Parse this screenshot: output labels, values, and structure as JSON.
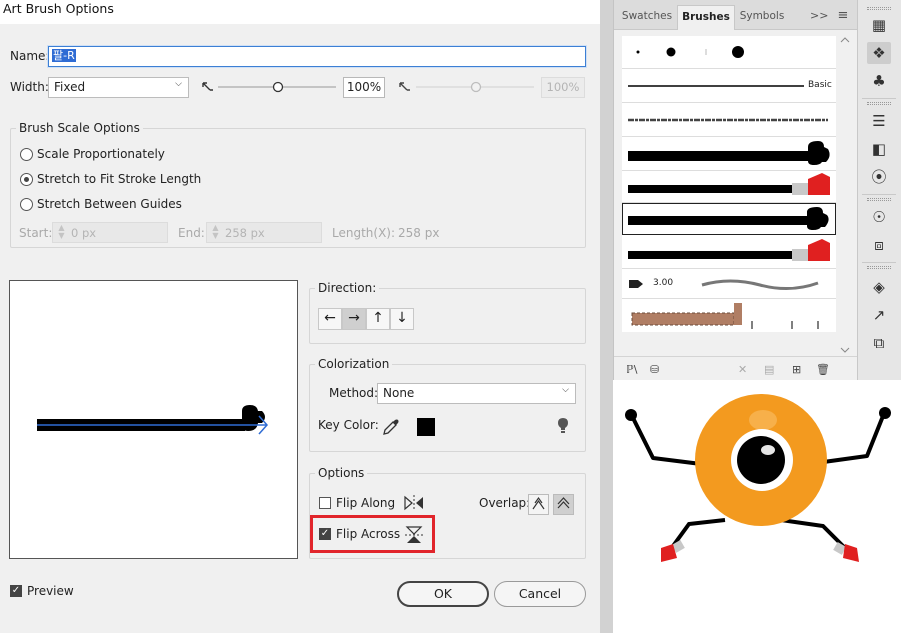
{
  "dialog": {
    "title": "Art Brush Options",
    "name_label": "Name:",
    "name_value": "팔-R",
    "width_label": "Width:",
    "width_value": "Fixed",
    "width_percent": "100%",
    "width_percent_disabled": "100%",
    "scale_group_label": "Brush Scale Options",
    "scale_options": [
      "Scale Proportionately",
      "Stretch to Fit Stroke Length",
      "Stretch Between Guides"
    ],
    "scale_selected": 1,
    "start_label": "Start:",
    "start_value": "0 px",
    "end_label": "End:",
    "end_value": "258 px",
    "length_label": "Length(X):",
    "length_value": "258 px",
    "direction_label": "Direction:",
    "direction_buttons": [
      "←",
      "→",
      "↑",
      "↓"
    ],
    "direction_selected": 1,
    "colorization_label": "Colorization",
    "method_label": "Method:",
    "method_value": "None",
    "key_color_label": "Key Color:",
    "key_color": "#000000",
    "options_label": "Options",
    "flip_along_label": "Flip Along",
    "flip_along_checked": false,
    "flip_across_label": "Flip Across",
    "flip_across_checked": true,
    "overlap_label": "Overlap:",
    "preview_label": "Preview",
    "preview_checked": true,
    "ok_label": "OK",
    "cancel_label": "Cancel"
  },
  "brushes_panel": {
    "tabs": [
      "Swatches",
      "Brushes",
      "Symbols"
    ],
    "active_tab": "Brushes",
    "more_glyph": ">>",
    "basic_label": "Basic",
    "size_label": "3.00"
  },
  "colors": {
    "accent": "#2f6cd4",
    "highlight_red": "#e1252b",
    "character_orange": "#f39a1f"
  }
}
